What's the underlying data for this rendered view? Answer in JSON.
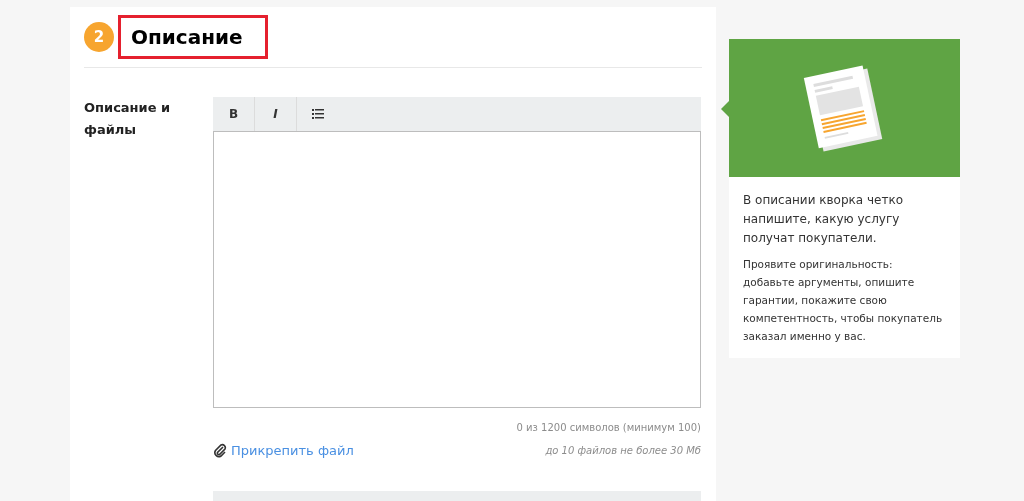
{
  "section": {
    "step": "2",
    "title": "Описание"
  },
  "field": {
    "label": "Описание и файлы",
    "toolbar": [
      {
        "kind": "text",
        "label": "B"
      },
      {
        "kind": "text",
        "label": "I"
      },
      {
        "kind": "list"
      }
    ],
    "counter": "0 из 1200 символов (минимум 100)",
    "attach": "Прикрепить файл",
    "limit": "до 10 файлов не более 30 Мб"
  },
  "tip": {
    "paragraphs": [
      "В описании кворка четко напишите, какую услугу получат покупатели.",
      "Проявите оригинальность: добавьте аргументы, опишите гарантии, покажите свою компетентность, чтобы покупатель заказал именно у вас."
    ]
  }
}
